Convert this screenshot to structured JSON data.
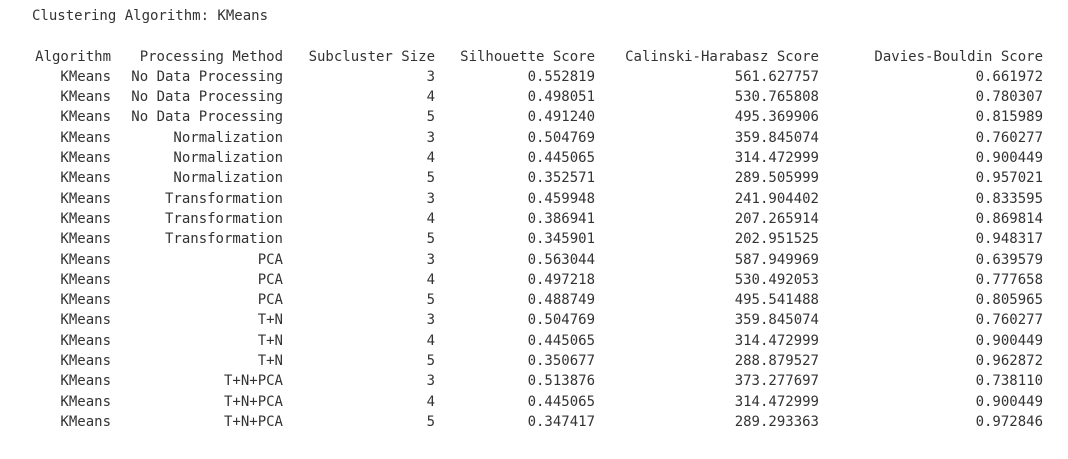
{
  "title": "Clustering Algorithm: KMeans",
  "table": {
    "columns": [
      "Algorithm",
      "Processing Method",
      "Subcluster Size",
      "Silhouette Score",
      "Calinski-Harabasz Score",
      "Davies-Bouldin Score"
    ],
    "rows": [
      [
        "KMeans",
        "No Data Processing",
        "3",
        "0.552819",
        "561.627757",
        "0.661972"
      ],
      [
        "KMeans",
        "No Data Processing",
        "4",
        "0.498051",
        "530.765808",
        "0.780307"
      ],
      [
        "KMeans",
        "No Data Processing",
        "5",
        "0.491240",
        "495.369906",
        "0.815989"
      ],
      [
        "KMeans",
        "Normalization",
        "3",
        "0.504769",
        "359.845074",
        "0.760277"
      ],
      [
        "KMeans",
        "Normalization",
        "4",
        "0.445065",
        "314.472999",
        "0.900449"
      ],
      [
        "KMeans",
        "Normalization",
        "5",
        "0.352571",
        "289.505999",
        "0.957021"
      ],
      [
        "KMeans",
        "Transformation",
        "3",
        "0.459948",
        "241.904402",
        "0.833595"
      ],
      [
        "KMeans",
        "Transformation",
        "4",
        "0.386941",
        "207.265914",
        "0.869814"
      ],
      [
        "KMeans",
        "Transformation",
        "5",
        "0.345901",
        "202.951525",
        "0.948317"
      ],
      [
        "KMeans",
        "PCA",
        "3",
        "0.563044",
        "587.949969",
        "0.639579"
      ],
      [
        "KMeans",
        "PCA",
        "4",
        "0.497218",
        "530.492053",
        "0.777658"
      ],
      [
        "KMeans",
        "PCA",
        "5",
        "0.488749",
        "495.541488",
        "0.805965"
      ],
      [
        "KMeans",
        "T+N",
        "3",
        "0.504769",
        "359.845074",
        "0.760277"
      ],
      [
        "KMeans",
        "T+N",
        "4",
        "0.445065",
        "314.472999",
        "0.900449"
      ],
      [
        "KMeans",
        "T+N",
        "5",
        "0.350677",
        "288.879527",
        "0.962872"
      ],
      [
        "KMeans",
        "T+N+PCA",
        "3",
        "0.513876",
        "373.277697",
        "0.738110"
      ],
      [
        "KMeans",
        "T+N+PCA",
        "4",
        "0.445065",
        "314.472999",
        "0.900449"
      ],
      [
        "KMeans",
        "T+N+PCA",
        "5",
        "0.347417",
        "289.293363",
        "0.972846"
      ]
    ]
  }
}
